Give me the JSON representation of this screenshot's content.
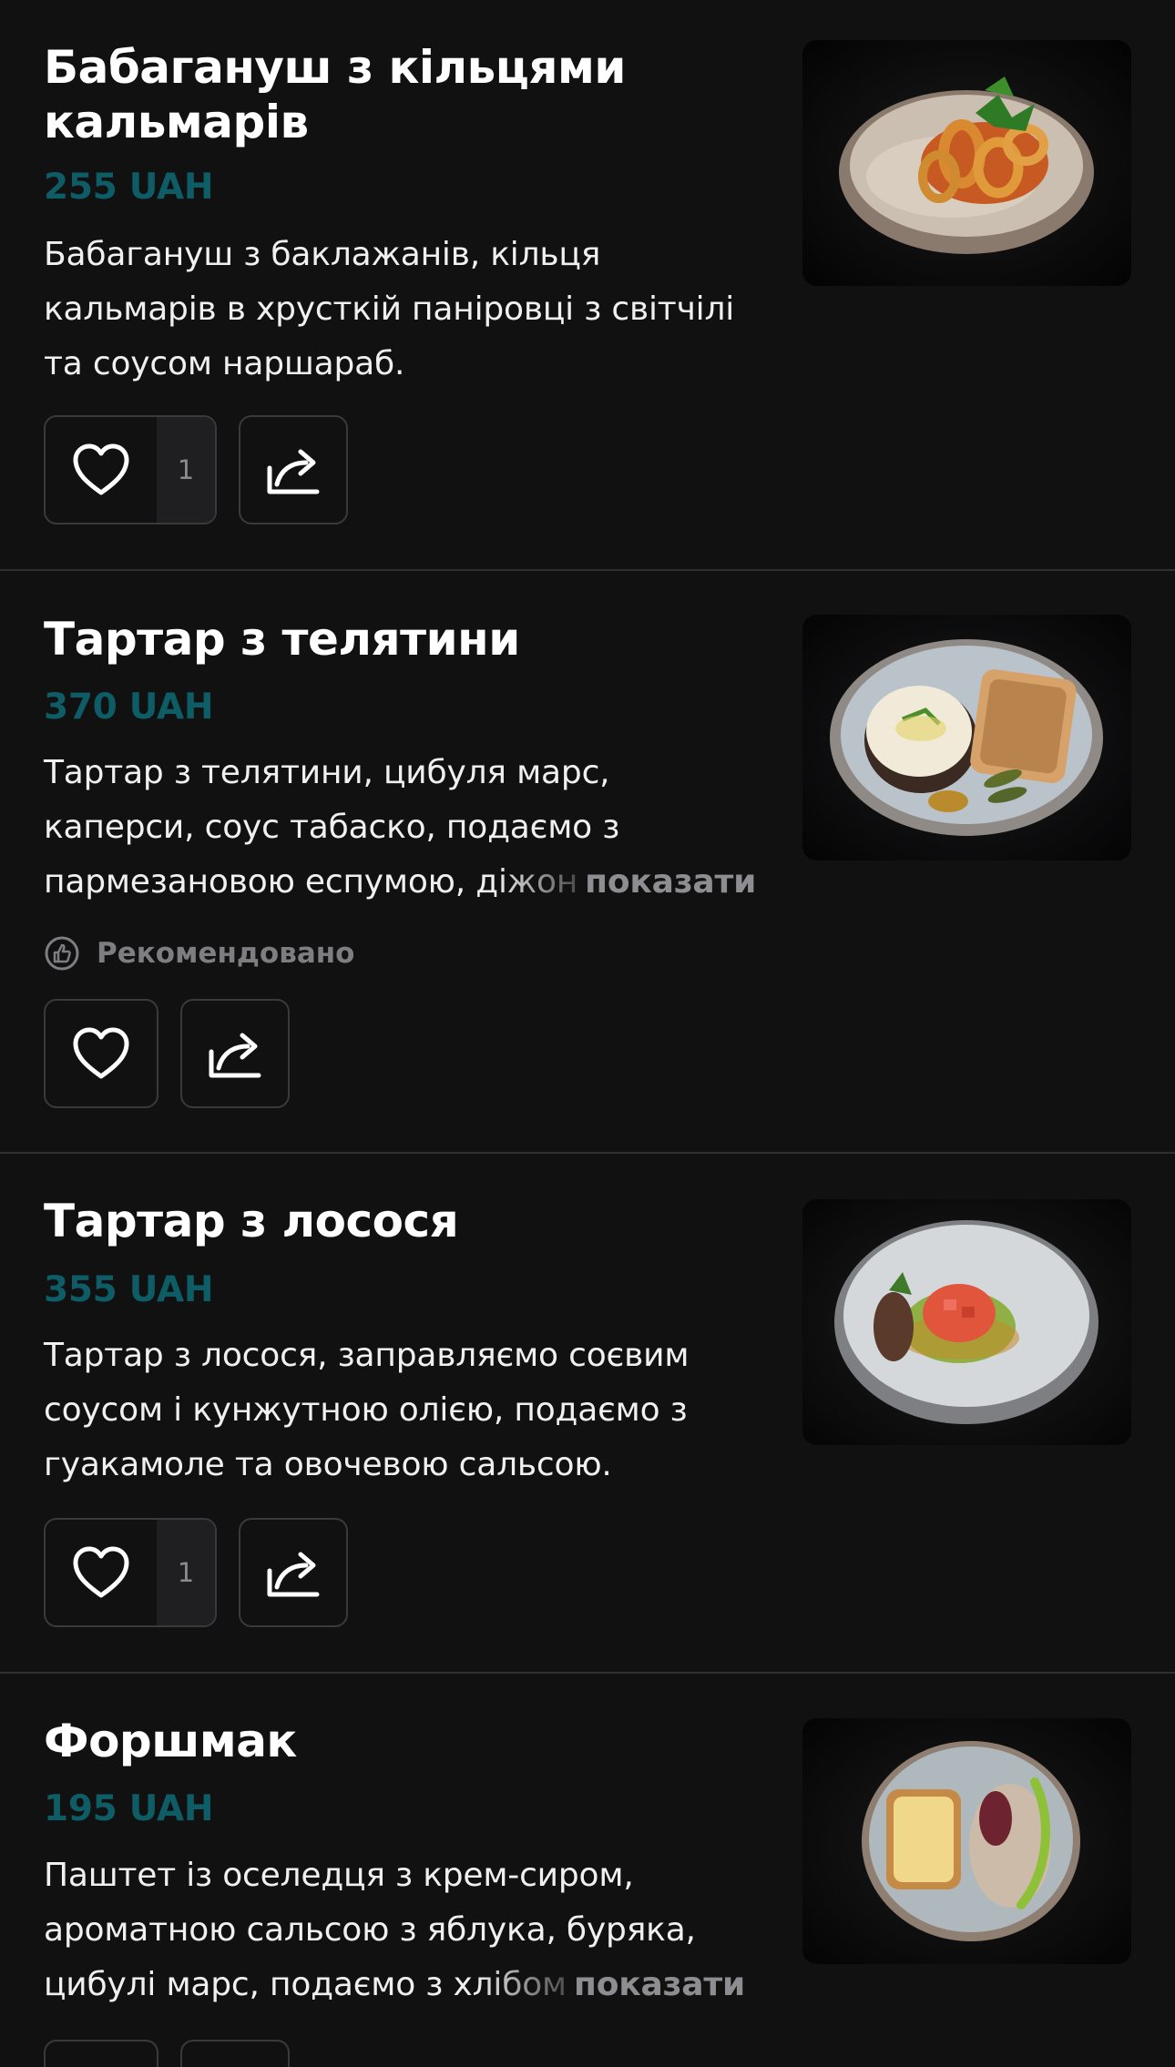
{
  "items": [
    {
      "title_lines": [
        "Бабагануш з кільцями",
        "кальмарів"
      ],
      "price": "255 UAH",
      "desc_lines": [
        "Бабагануш з баклажанів, кільця",
        "кальмарів в хрусткій паніровці з світчілі",
        "та соусом наршараб."
      ],
      "likes": "1",
      "photo": "squid-rings-baba-ganoush-photo"
    },
    {
      "title_lines": [
        "Тартар з телятини"
      ],
      "price": "370 UAH",
      "desc_lines": [
        "Тартар з телятини, цибуля марс,",
        "каперси, соус табаско, подаємо з"
      ],
      "desc_last_visible": "пармезановою еспумою, ",
      "desc_last_faded": "діжон",
      "more_label": "показати",
      "recommended_label": "Рекомендовано",
      "photo": "veal-tartare-toast-photo"
    },
    {
      "title_lines": [
        "Тартар з лосося"
      ],
      "price": "355 UAH",
      "desc_lines": [
        "Тартар з лосося, заправляємо соєвим",
        "соусом і кунжутною олією, подаємо з",
        "гуакамоле та овочевою сальсою."
      ],
      "likes": "1",
      "photo": "salmon-tartare-guacamole-photo"
    },
    {
      "title_lines": [
        "Форшмак"
      ],
      "price": "195 UAH",
      "desc_lines": [
        "Паштет із оселедця з крем-сиром,",
        "ароматною сальсою з яблука, буряка,"
      ],
      "desc_last_visible": "цибулі марс, подаємо з ",
      "desc_last_faded": "хлібом",
      "more_label": "показати",
      "photo": "forshmak-toast-photo"
    }
  ],
  "icons": {
    "like": "heart-icon",
    "share": "share-arrow-icon",
    "recommended": "thumbs-up-circle-icon"
  },
  "colors": {
    "background": "#111112",
    "price": "#0d5c66",
    "divider": "#303033",
    "muted": "#8e8e92"
  }
}
